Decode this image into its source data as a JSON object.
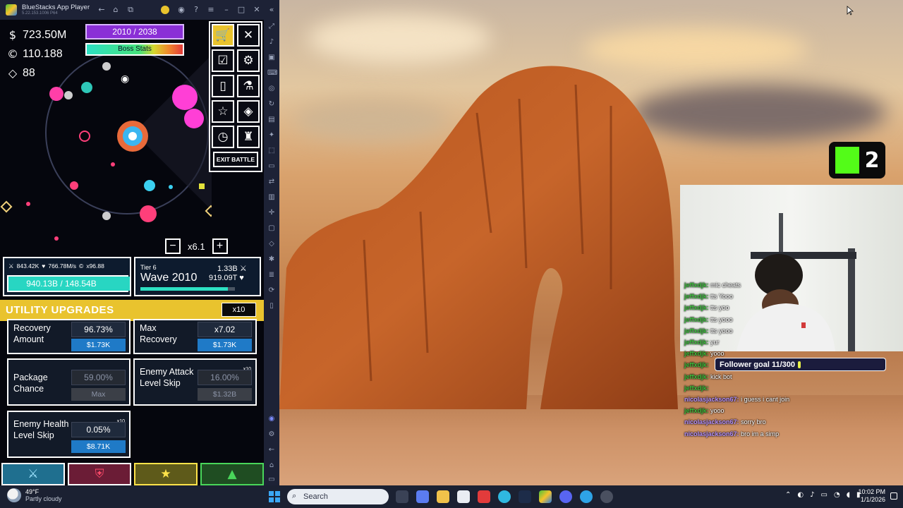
{
  "window": {
    "title": "BlueStacks App Player",
    "version": "5.22.153.1006 P64"
  },
  "game": {
    "cash": "723.50M",
    "coins": "110.188",
    "gems": "88",
    "wave_progress": "2010 / 2038",
    "boss_label": "Boss Stats",
    "exit_battle": "EXIT BATTLE",
    "speed": "x6.1",
    "speed_minus": "−",
    "speed_plus": "+",
    "player": {
      "damage": "843.42K",
      "regen": "766.78M/s",
      "coin_mult": "x96.88",
      "hp": "940.13B / 148.54B"
    },
    "enemy": {
      "tier": "Tier 6",
      "wave": "Wave 2010",
      "attack": "1.33B",
      "health": "919.09T"
    },
    "upgrades": {
      "title": "UTILITY UPGRADES",
      "multiplier": "x10",
      "items": [
        {
          "name": "Recovery Amount",
          "value": "96.73%",
          "cost": "$1.73K"
        },
        {
          "name": "Max Recovery",
          "value": "x7.02",
          "cost": "$1.73K"
        },
        {
          "name": "Package Chance",
          "value": "59.00%",
          "cost": "Max"
        },
        {
          "name": "Enemy Attack Level Skip",
          "value": "16.00%",
          "cost": "$1.32B",
          "badge": "x10"
        },
        {
          "name": "Enemy Health Level Skip",
          "value": "0.05%",
          "cost": "$8.71K",
          "badge": "x10"
        }
      ]
    }
  },
  "stream": {
    "kick_count": "2",
    "follower_goal": "Follower goal 11/300",
    "chat": [
      {
        "user": "jeffxdjk:",
        "msg": "mic cheats",
        "color": "green"
      },
      {
        "user": "jeffxdjk:",
        "msg": "tts Yooo",
        "color": "green"
      },
      {
        "user": "jeffxdjk:",
        "msg": "tts yoo",
        "color": "green"
      },
      {
        "user": "jeffxdjk:",
        "msg": "tts yooo",
        "color": "green"
      },
      {
        "user": "jeffxdjk:",
        "msg": "tts yooo",
        "color": "green"
      },
      {
        "user": "jeffxdjk:",
        "msg": "yur",
        "color": "green"
      },
      {
        "user": "jeffxdjk:",
        "msg": "yooo",
        "color": "green"
      },
      {
        "user": "jeffxdjk:",
        "msg": "",
        "color": "green"
      },
      {
        "user": "jeffxdjk:",
        "msg": "kick bot",
        "color": "green"
      },
      {
        "user": "jeffxdjk:",
        "msg": "",
        "color": "green"
      },
      {
        "user": "nicolasjackson67:",
        "msg": "i guess i cant join",
        "color": "purple"
      },
      {
        "user": "jeffxdjk:",
        "msg": "yooo",
        "color": "green"
      },
      {
        "user": "nicolasjackson67:",
        "msg": "sorry bro",
        "color": "purple"
      },
      {
        "user": "nicolasjackson67:",
        "msg": "bro im a simp",
        "color": "purple"
      }
    ]
  },
  "taskbar": {
    "weather_temp": "49°F",
    "weather_desc": "Partly cloudy",
    "search_placeholder": "Search",
    "time": "10:02 PM",
    "date": "1/1/2026"
  },
  "colors": {
    "kick_green": "#53fc18",
    "upgrade_header": "#e9c32e",
    "wave_bar": "#8a2fd6"
  }
}
